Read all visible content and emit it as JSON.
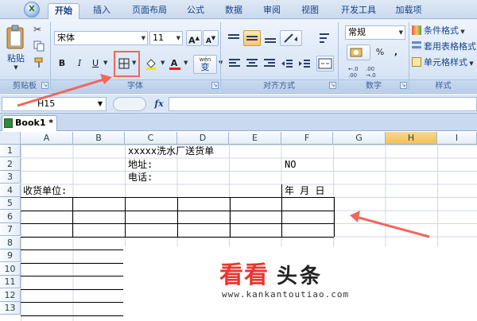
{
  "app": {
    "office_button": "X",
    "tabs": [
      "开始",
      "插入",
      "页面布局",
      "公式",
      "数据",
      "审阅",
      "视图",
      "开发工具",
      "加载项"
    ]
  },
  "ribbon": {
    "clipboard": {
      "paste_label": "粘贴",
      "group_label": "剪贴板"
    },
    "font": {
      "font_name": "宋体",
      "font_size": "11",
      "grow_label": "A",
      "shrink_label": "A",
      "bold": "B",
      "italic": "I",
      "underline": "U",
      "font_color_label": "A",
      "wen_label": "wén",
      "wen_char": "变",
      "group_label": "字体"
    },
    "alignment": {
      "group_label": "对齐方式"
    },
    "number": {
      "format": "常规",
      "percent": "%",
      "comma": ",",
      "group_label": "数字"
    },
    "styles": {
      "items": [
        "条件格式",
        "套用表格格式",
        "单元格样式"
      ],
      "group_label": "样式"
    }
  },
  "formula_bar": {
    "name_box": "H15",
    "fx": "fx"
  },
  "workbook_tab": "Book1 *",
  "grid": {
    "columns": [
      "A",
      "B",
      "C",
      "D",
      "E",
      "F",
      "G",
      "H",
      "I"
    ],
    "selected_column": "H",
    "rows": [
      "1",
      "2",
      "3",
      "4",
      "5",
      "6",
      "7",
      "8",
      "9",
      "10",
      "11",
      "12",
      "13"
    ],
    "cells": {
      "C1": "xxxxx洗水厂送货单",
      "C2": "地址:",
      "F2": "NO",
      "C3": "电话:",
      "A4": "收货单位:",
      "F4": "年 月 日"
    }
  },
  "watermark": {
    "brand_red": "看看",
    "brand_black": "头条",
    "url": "www.kankantoutiao.com"
  },
  "colors": {
    "accent_red": "#f0675c",
    "ribbon_blue": "#15428b",
    "selected_header": "#f1c15c"
  }
}
